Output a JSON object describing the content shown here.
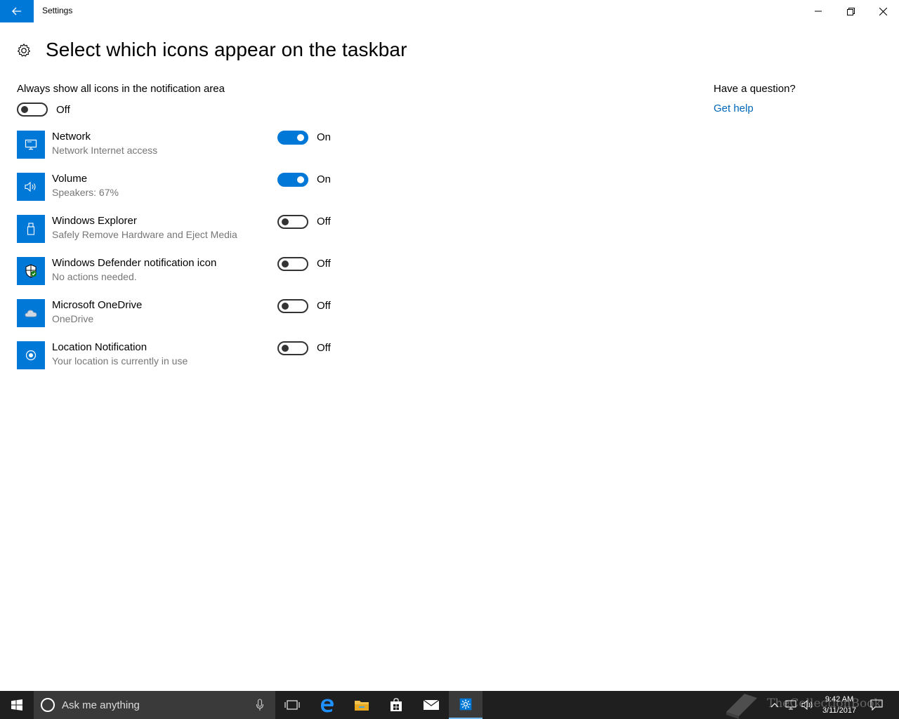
{
  "window": {
    "title": "Settings"
  },
  "page": {
    "title": "Select which icons appear on the taskbar"
  },
  "always_show": {
    "label": "Always show all icons in the notification area",
    "state": "Off"
  },
  "items": [
    {
      "name": "Network",
      "description": "Network Internet access",
      "state": "On",
      "icon": "network-monitor-icon"
    },
    {
      "name": "Volume",
      "description": "Speakers: 67%",
      "state": "On",
      "icon": "speaker-icon"
    },
    {
      "name": "Windows Explorer",
      "description": "Safely Remove Hardware and Eject Media",
      "state": "Off",
      "icon": "usb-drive-icon"
    },
    {
      "name": "Windows Defender notification icon",
      "description": "No actions needed.",
      "state": "Off",
      "icon": "defender-shield-icon"
    },
    {
      "name": "Microsoft OneDrive",
      "description": "OneDrive",
      "state": "Off",
      "icon": "cloud-icon"
    },
    {
      "name": "Location Notification",
      "description": "Your location is currently in use",
      "state": "Off",
      "icon": "location-icon"
    }
  ],
  "help": {
    "question": "Have a question?",
    "link": "Get help"
  },
  "taskbar": {
    "search_placeholder": "Ask me anything",
    "time": "9:42 AM",
    "date": "3/11/2017",
    "watermark": "TheCollectionBook"
  },
  "colors": {
    "accent": "#0078d7",
    "link": "#0067b8",
    "taskbar": "#1f1f1f"
  }
}
